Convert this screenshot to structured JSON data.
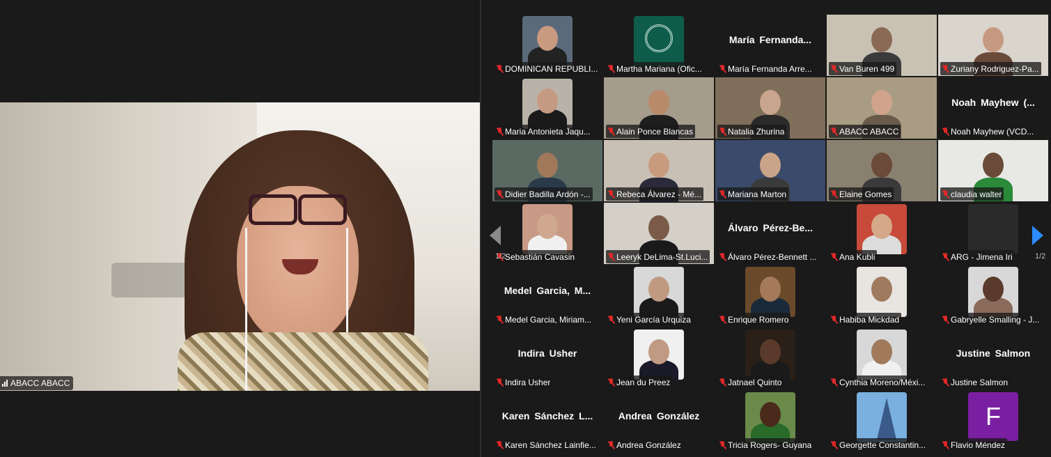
{
  "speaker": {
    "name": "ABACC ABACC"
  },
  "pagination": {
    "left_page": "1/2",
    "right_page": "1/2"
  },
  "colors": {
    "active_border": "#23d959",
    "mic_muted": "#e02828",
    "nav_arrow_active": "#2d8cff",
    "avatar_purple": "#7b1fa2"
  },
  "tiles": [
    {
      "name": "DOMINICAN REPUBLI...",
      "big": ""
    },
    {
      "name": "Martha Mariana (Ofic...",
      "big": ""
    },
    {
      "name": "María Fernanda Arre...",
      "big": "María  Fernanda..."
    },
    {
      "name": "Van Buren 499",
      "big": ""
    },
    {
      "name": "Zuriany Rodriguez-Pa...",
      "big": ""
    },
    {
      "name": "Maria Antonieta Jaqu...",
      "big": ""
    },
    {
      "name": "Alain Ponce Blancas",
      "big": ""
    },
    {
      "name": "Natalia Zhurina",
      "big": ""
    },
    {
      "name": "ABACC ABACC",
      "big": ""
    },
    {
      "name": "Noah Mayhew (VCD...",
      "big": "Noah  Mayhew  (..."
    },
    {
      "name": "Didier Badilla Ardón -...",
      "big": ""
    },
    {
      "name": "Rebeca Álvarez - Mé...",
      "big": ""
    },
    {
      "name": "Mariana Marton",
      "big": ""
    },
    {
      "name": "Elaine Gomes",
      "big": ""
    },
    {
      "name": "claudia walter",
      "big": ""
    },
    {
      "name": "Sebastián Cavasin",
      "big": ""
    },
    {
      "name": "Leeryk DeLima-St.Luci...",
      "big": ""
    },
    {
      "name": "Álvaro Pérez-Bennett ...",
      "big": "Álvaro  Pérez-Be..."
    },
    {
      "name": "Ana Kubli",
      "big": ""
    },
    {
      "name": "ARG - Jimena Iri",
      "big": ""
    },
    {
      "name": "Medel Garcia, Miriam...",
      "big": "Medel  Garcia,  M..."
    },
    {
      "name": "Yeni García Urquiza",
      "big": ""
    },
    {
      "name": "Enrique Romero",
      "big": ""
    },
    {
      "name": "Habiba Mickdad",
      "big": ""
    },
    {
      "name": "Gabryelle Smalling - J...",
      "big": ""
    },
    {
      "name": "Indira Usher",
      "big": "Indira Usher"
    },
    {
      "name": "Jean du Preez",
      "big": ""
    },
    {
      "name": "Jatnael Quinto",
      "big": ""
    },
    {
      "name": "Cynthia Moreno/Méxi...",
      "big": ""
    },
    {
      "name": "Justine Salmon",
      "big": "Justine Salmon"
    },
    {
      "name": "Karen Sánchez Lainfie...",
      "big": "Karen  Sánchez  L..."
    },
    {
      "name": "Andrea González",
      "big": "Andrea González"
    },
    {
      "name": "Tricia Rogers- Guyana",
      "big": ""
    },
    {
      "name": "Georgette Constantin...",
      "big": ""
    },
    {
      "name": "Flavio Méndez",
      "big": "",
      "avatar_letter": "F"
    }
  ]
}
